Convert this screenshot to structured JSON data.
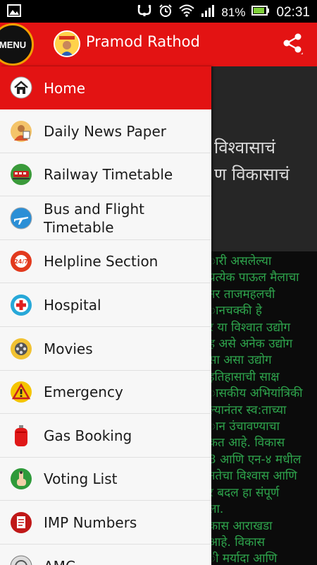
{
  "status_bar": {
    "battery": "81%",
    "time": "02:31"
  },
  "action_bar": {
    "menu_label": "MENU",
    "title": "Pramod Rathod",
    "share_icon": "share-icon"
  },
  "drawer": {
    "items": [
      {
        "label": "Home",
        "icon": "home-icon"
      },
      {
        "label": "Daily News Paper",
        "icon": "newspaper-icon"
      },
      {
        "label": "Railway Timetable",
        "icon": "train-icon"
      },
      {
        "label": "Bus and Flight\nTimetable",
        "icon": "airplane-icon"
      },
      {
        "label": "Helpline Section",
        "icon": "helpline-247-icon"
      },
      {
        "label": "Hospital",
        "icon": "hospital-icon"
      },
      {
        "label": "Movies",
        "icon": "film-reel-icon"
      },
      {
        "label": "Emergency",
        "icon": "warning-icon"
      },
      {
        "label": "Gas Booking",
        "icon": "gas-cylinder-icon"
      },
      {
        "label": "Voting List",
        "icon": "voting-finger-icon"
      },
      {
        "label": "IMP Numbers",
        "icon": "notepad-icon"
      },
      {
        "label": "AMC",
        "icon": "emblem-icon"
      }
    ]
  },
  "background_content": {
    "banner_lines": [
      "विश्वासाचं",
      "ण विकासाचं"
    ],
    "article_lines": [
      "ारी असलेल्या",
      "प्रत्येक पाऊल मैलाचा",
      "नर ताजमहलची",
      "ानचक्की हे",
      "र या विश्वात उद्योग",
      "ह असे अनेक उद्योग",
      "सा असा उद्योग",
      "इतिहासाची साक्ष",
      "ासकीय अभियांत्रिकी",
      "ल्यानंतर स्व:ताच्या",
      "ान उंचावण्याचा",
      "कत आहे. विकास",
      "3 आणि एन-४ मधील",
      "नतेचा विश्वास आणि",
      "र बदल हा संपूर्ण",
      "ला.",
      "कास आराखडा",
      "आहे. विकास",
      "ी मर्यादा आणि"
    ]
  },
  "colors": {
    "accent": "#e31313",
    "drawer_bg": "#f7f7f7",
    "article_text": "#2ea44c"
  }
}
